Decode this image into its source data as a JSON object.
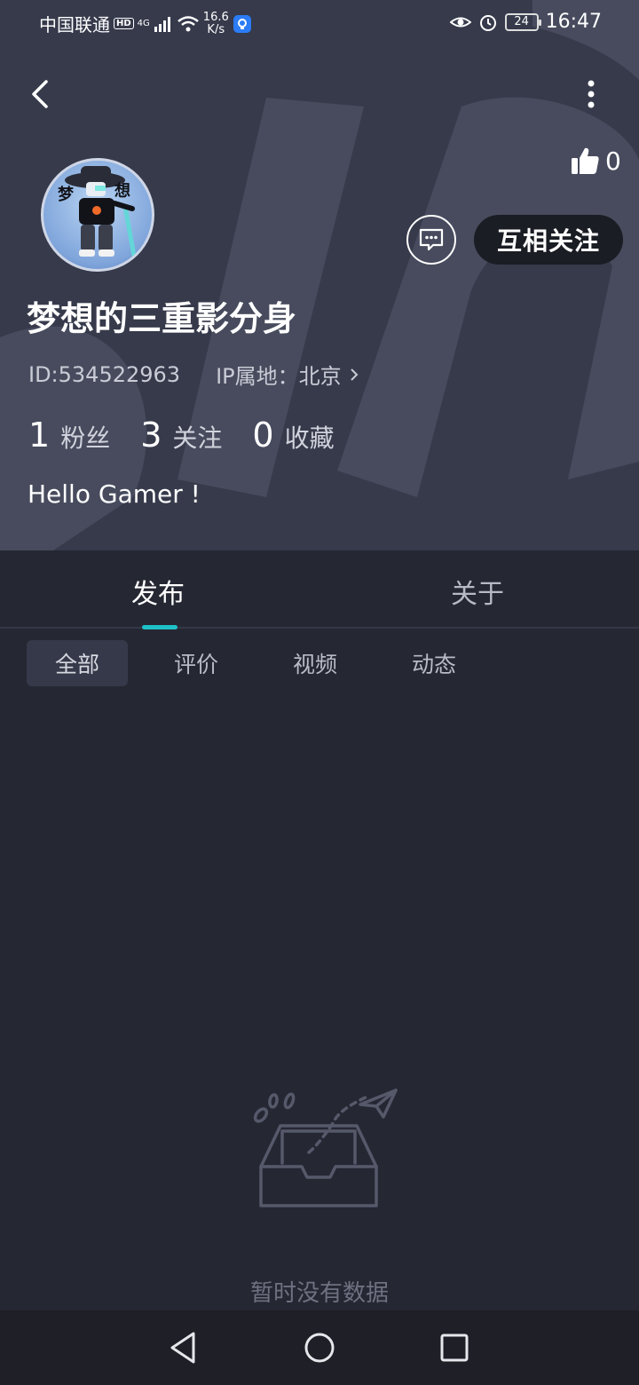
{
  "status_bar": {
    "carrier": "中国联通",
    "hd": "HD",
    "network": "4G",
    "speed_value": "16.6",
    "speed_unit": "K/s",
    "battery": "24",
    "time": "16:47"
  },
  "profile": {
    "like_count": "0",
    "username": "梦想的三重影分身",
    "id": "ID:534522963",
    "ip_location": "IP属地：北京",
    "follow_button": "互相关注",
    "bio": "Hello Gamer !",
    "stats": [
      {
        "num": "1",
        "label": "粉丝"
      },
      {
        "num": "3",
        "label": "关注"
      },
      {
        "num": "0",
        "label": "收藏"
      }
    ],
    "avatar_text": [
      "梦",
      "想"
    ]
  },
  "tabs": [
    {
      "label": "发布",
      "active": true
    },
    {
      "label": "关于",
      "active": false
    }
  ],
  "filters": [
    {
      "label": "全部",
      "active": true
    },
    {
      "label": "评价",
      "active": false
    },
    {
      "label": "视频",
      "active": false
    },
    {
      "label": "动态",
      "active": false
    }
  ],
  "empty_state": {
    "text": "暂时没有数据"
  },
  "colors": {
    "header_bg": "#363a4b",
    "page_bg": "#252733",
    "accent": "#1ec1c7"
  },
  "icons": {
    "back": "chevron-left-icon",
    "more": "more-vertical-icon",
    "like": "thumbs-up-icon",
    "message": "chat-bubble-icon",
    "empty": "empty-box-icon"
  }
}
